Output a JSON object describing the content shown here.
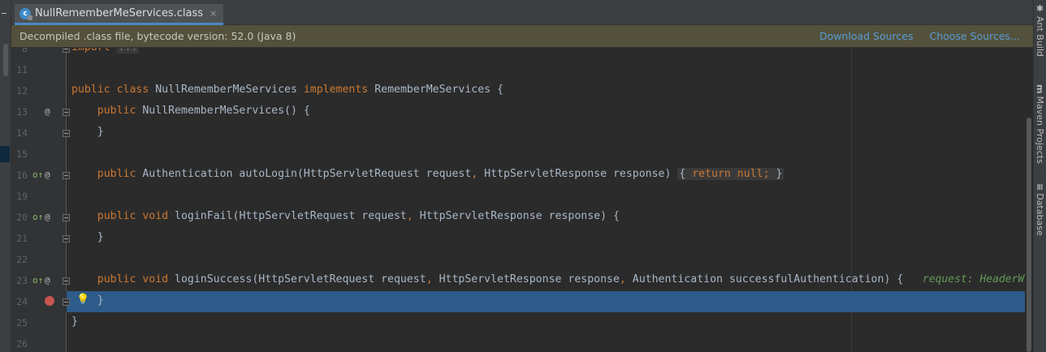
{
  "tab": {
    "label": "NullRememberMeServices.class",
    "icon": "class-file-icon",
    "close": "×",
    "icon_letter": "c"
  },
  "banner": {
    "text": "Decompiled .class file, bytecode version: 52.0 (Java 8)",
    "download_sources": "Download Sources",
    "choose_sources": "Choose Sources..."
  },
  "right_tools": [
    {
      "label": "Ant Build",
      "icon": "ant-icon",
      "glyph": "✱"
    },
    {
      "label": "Maven Projects",
      "icon": "maven-icon",
      "glyph": "m"
    },
    {
      "label": "Database",
      "icon": "database-icon",
      "glyph": "≡"
    }
  ],
  "editor": {
    "lines": [
      {
        "num": "8",
        "code": "import ..."
      },
      {
        "num": "11",
        "code": ""
      },
      {
        "num": "12",
        "code": "public class NullRememberMeServices implements RememberMeServices {"
      },
      {
        "num": "13",
        "code": "public NullRememberMeServices() {"
      },
      {
        "num": "14",
        "code": "}"
      },
      {
        "num": "15",
        "code": ""
      },
      {
        "num": "16",
        "code": "public Authentication autoLogin(HttpServletRequest request, HttpServletResponse response) { return null; }"
      },
      {
        "num": "19",
        "code": ""
      },
      {
        "num": "20",
        "code": "public void loginFail(HttpServletRequest request, HttpServletResponse response) {"
      },
      {
        "num": "21",
        "code": "}"
      },
      {
        "num": "22",
        "code": ""
      },
      {
        "num": "23",
        "code": "public void loginSuccess(HttpServletRequest request, HttpServletResponse response, Authentication successfulAuthentication) {"
      },
      {
        "num": "24",
        "code": "}"
      },
      {
        "num": "25",
        "code": "}"
      },
      {
        "num": "26",
        "code": ""
      }
    ],
    "inline_hint": "request: HeaderWr",
    "caret_line": "24"
  },
  "colors": {
    "background": "#2b2b2b",
    "keyword": "#cc7832",
    "text": "#a9b7c6",
    "banner_bg": "#53513b",
    "link": "#5a9bd6",
    "caret_line": "#2d5b8a",
    "hint": "#629755"
  }
}
